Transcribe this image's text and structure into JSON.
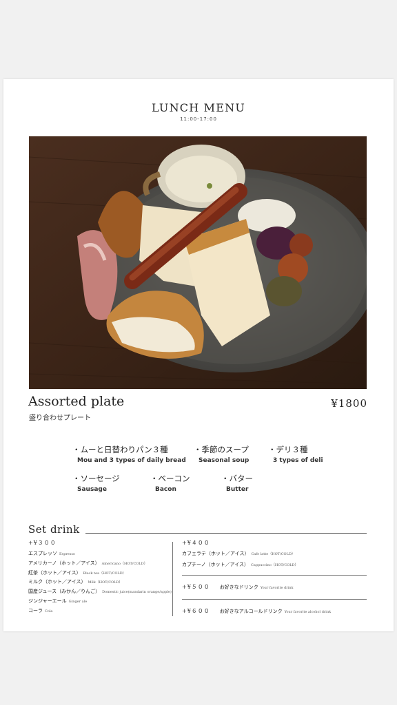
{
  "menu": {
    "title": "LUNCH MENU",
    "hours": "11:00-17:00"
  },
  "plate": {
    "name": "Assorted plate",
    "name_jp": "盛り合わせプレート",
    "price": "¥1800"
  },
  "items": [
    {
      "jp": "・ムーと日替わりパン３種",
      "en": "Mou and 3 types of daily bread"
    },
    {
      "jp": "・季節のスープ",
      "en": "Seasonal soup"
    },
    {
      "jp": "・デリ３種",
      "en": "3 types of deli"
    },
    {
      "jp": "・ソーセージ",
      "en": "Sausage"
    },
    {
      "jp": "・ベーコン",
      "en": "Bacon"
    },
    {
      "jp": "・バター",
      "en": "Butter"
    }
  ],
  "set_drink": {
    "title": "Set drink",
    "group_300": {
      "price": "+¥３００",
      "drinks": [
        {
          "jp": "エスプレッソ",
          "en": "Espresso"
        },
        {
          "jp": "アメリカーノ（ホット／アイス）",
          "en": "Americano（HOT/COLD）"
        },
        {
          "jp": "紅茶（ホット／アイス）",
          "en": "Black tea（HOT/COLD）"
        },
        {
          "jp": "ミルク（ホット／アイス）",
          "en": "Milk（HOT/COLD）"
        },
        {
          "jp": "国産ジュース（みかん／りんご）",
          "en": "Domestic juice(mandarin orange/apple)"
        },
        {
          "jp": "ジンジャーエール",
          "en": "Ginger ale"
        },
        {
          "jp": "コーラ",
          "en": "Cola"
        }
      ]
    },
    "group_400": {
      "price": "+¥４００",
      "drinks": [
        {
          "jp": "カフェラテ（ホット／アイス）",
          "en": "Cafe latte（HOT/COLD）"
        },
        {
          "jp": "カプチーノ（ホット／アイス）",
          "en": "Cappuccino（HOT/COLD）"
        }
      ]
    },
    "group_500": {
      "price": "+¥５００",
      "jp": "お好きなドリンク",
      "en": "Your favorite drink"
    },
    "group_600": {
      "price": "+¥６００",
      "jp": "お好きなアルコールドリンク",
      "en": "Your favorite alcohol drink"
    }
  }
}
